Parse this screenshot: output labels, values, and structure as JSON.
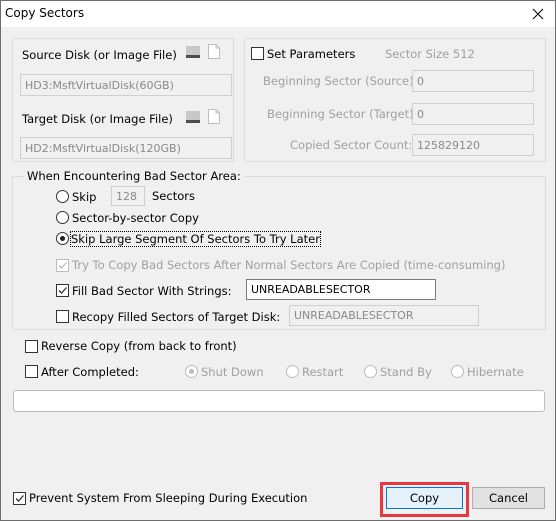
{
  "window": {
    "title": "Copy Sectors"
  },
  "source": {
    "label": "Source Disk (or Image File)",
    "value": "HD3:MsftVirtualDisk(60GB)"
  },
  "target": {
    "label": "Target Disk (or Image File)",
    "value": "HD2:MsftVirtualDisk(120GB)"
  },
  "params": {
    "set_label": "Set Parameters",
    "set_checked": false,
    "sector_size": "Sector Size 512",
    "begin_source_label": "Beginning Sector (Source):",
    "begin_source_value": "0",
    "begin_target_label": "Beginning Sector (Target):",
    "begin_target_value": "0",
    "count_label": "Copied Sector Count:",
    "count_value": "125829120"
  },
  "bad_sector": {
    "legend": "When Encountering Bad Sector Area:",
    "skip_label": "Skip",
    "skip_value": "128",
    "skip_unit": "Sectors",
    "sector_by_sector_label": "Sector-by-sector Copy",
    "skip_large_label": "Skip Large Segment Of Sectors To Try Later",
    "selected": "skip_large",
    "try_copy_label": "Try To Copy Bad Sectors After Normal Sectors Are Copied (time-consuming)",
    "try_copy_checked": true,
    "fill_label": "Fill Bad Sector With Strings:",
    "fill_checked": true,
    "fill_value": "UNREADABLESECTOR",
    "recopy_label": "Recopy Filled Sectors of Target Disk:",
    "recopy_checked": false,
    "recopy_value": "UNREADABLESECTOR"
  },
  "options": {
    "reverse_label": "Reverse Copy (from back to front)",
    "reverse_checked": false,
    "after_label": "After Completed:",
    "after_checked": false,
    "after_options": [
      "Shut Down",
      "Restart",
      "Stand By",
      "Hibernate"
    ],
    "after_selected": "Shut Down"
  },
  "progress": {
    "value": 0
  },
  "footer": {
    "prevent_sleep_label": "Prevent System From Sleeping During Execution",
    "prevent_sleep_checked": true,
    "copy_label": "Copy",
    "cancel_label": "Cancel"
  },
  "colors": {
    "accent": "#0078d7",
    "highlight": "#e8383d"
  }
}
